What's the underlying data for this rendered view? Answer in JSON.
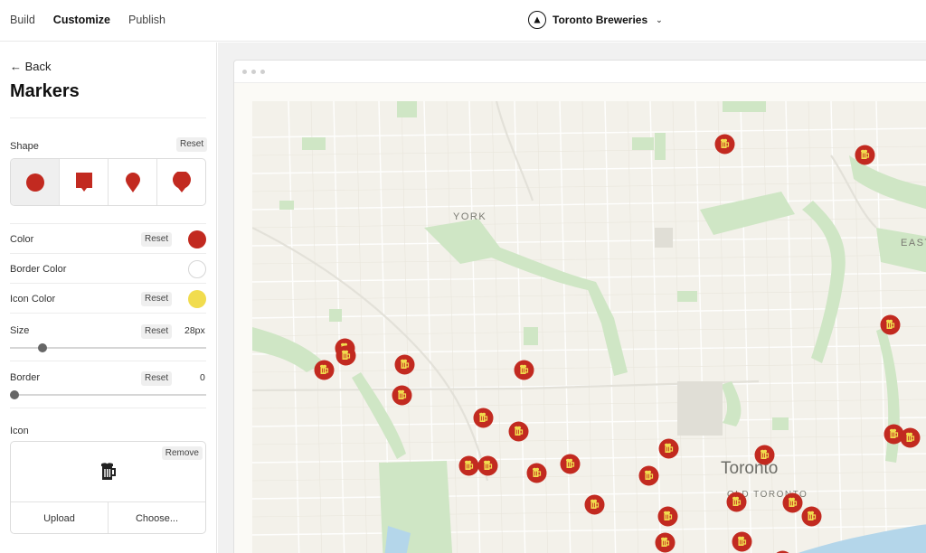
{
  "nav": {
    "tabs": [
      "Build",
      "Customize",
      "Publish"
    ],
    "active": "Customize"
  },
  "project": {
    "name": "Toronto Breweries"
  },
  "sidebar": {
    "back": "← Back",
    "title": "Markers",
    "shape": {
      "label": "Shape",
      "reset": "Reset",
      "options": [
        "circle",
        "square-pin",
        "pin",
        "round-pin"
      ],
      "selected": 0
    },
    "color": {
      "label": "Color",
      "reset": "Reset",
      "value": "#c22a20"
    },
    "border_color": {
      "label": "Border Color",
      "value": "#ffffff"
    },
    "icon_color": {
      "label": "Icon Color",
      "reset": "Reset",
      "value": "#f1dc4e"
    },
    "size": {
      "label": "Size",
      "reset": "Reset",
      "value": "28px",
      "fraction": 0.15
    },
    "border": {
      "label": "Border",
      "reset": "Reset",
      "value": "0",
      "fraction": 0
    },
    "icon": {
      "label": "Icon",
      "remove": "Remove",
      "upload": "Upload",
      "choose": "Choose...",
      "name": "beer-mug-icon"
    }
  },
  "map": {
    "labels": {
      "york": "YORK",
      "east": "EAST",
      "city": "Toronto",
      "old_toronto": "OLD TORONTO"
    },
    "marker_fill": "#c22a20",
    "marker_icon_color": "#f1dc4e",
    "marker_count": 28
  }
}
